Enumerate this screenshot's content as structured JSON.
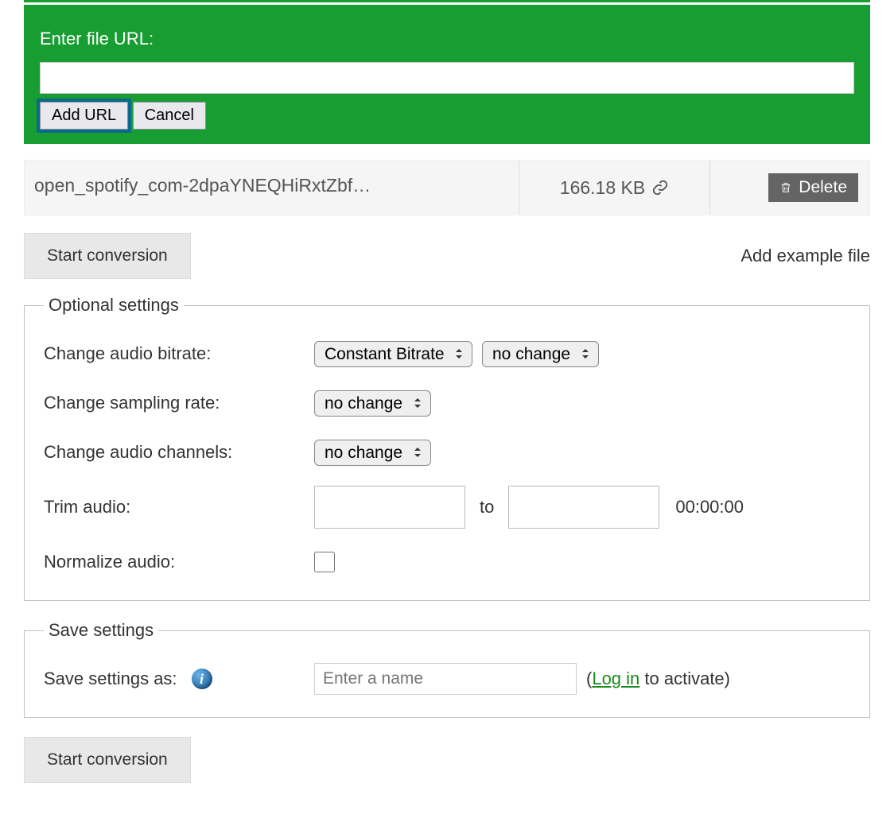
{
  "url_panel": {
    "label": "Enter file URL:",
    "value": "",
    "add_label": "Add URL",
    "cancel_label": "Cancel"
  },
  "file": {
    "name": "open_spotify_com-2dpaYNEQHiRxtZbf…",
    "size": "166.18 KB",
    "delete_label": "Delete"
  },
  "start_label": "Start conversion",
  "example_label": "Add example file",
  "optional": {
    "legend": "Optional settings",
    "bitrate_label": "Change audio bitrate:",
    "bitrate_mode": "Constant Bitrate",
    "bitrate_value": "no change",
    "sampling_label": "Change sampling rate:",
    "sampling_value": "no change",
    "channels_label": "Change audio channels:",
    "channels_value": "no change",
    "trim_label": "Trim audio:",
    "trim_to": "to",
    "trim_duration": "00:00:00",
    "normalize_label": "Normalize audio:"
  },
  "save": {
    "legend": "Save settings",
    "label": "Save settings as:",
    "placeholder": "Enter a name",
    "note_open": "(",
    "login": "Log in",
    "note_rest": " to activate)"
  }
}
